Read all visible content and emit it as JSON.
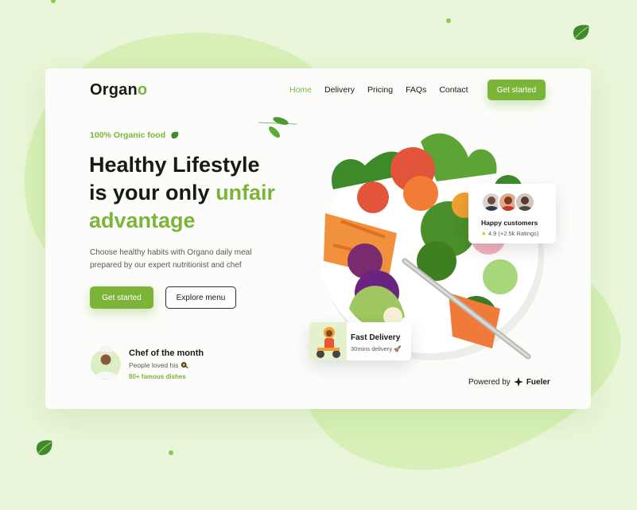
{
  "brand": {
    "logo_main": "Organ",
    "logo_accent": "o",
    "accent_color": "#7ab53a"
  },
  "nav": {
    "items": [
      {
        "label": "Home",
        "active": true
      },
      {
        "label": "Delivery",
        "active": false
      },
      {
        "label": "Pricing",
        "active": false
      },
      {
        "label": "FAQs",
        "active": false
      },
      {
        "label": "Contact",
        "active": false
      }
    ],
    "cta_label": "Get started"
  },
  "hero": {
    "tagline": "100% Organic food",
    "headline_line1": "Healthy Lifestyle",
    "headline_line2_prefix": "is your only",
    "headline_line2_accent": "unfair",
    "headline_line3": "advantage",
    "description": "Choose healthy habits with Organo daily meal prepared by our expert nutritionist and chef",
    "primary_cta": "Get started",
    "secondary_cta": "Explore menu"
  },
  "chef": {
    "title": "Chef of the month",
    "subtitle": "People loved his",
    "dishes": "80+ famous dishes"
  },
  "customers_card": {
    "title": "Happy customers",
    "rating": "4.9",
    "rating_count": "(+2.5k Ratings)"
  },
  "delivery_card": {
    "title": "Fast Delivery",
    "subtitle": "30mins delivery"
  },
  "footer": {
    "powered_label": "Powered by",
    "powered_brand": "Fueler"
  },
  "icons": {
    "tagline": "leaf-icon",
    "chef_subtitle": "food-icon",
    "delivery": "rocket-icon",
    "rating": "star-icon",
    "fueler": "fueler-logo-icon"
  }
}
